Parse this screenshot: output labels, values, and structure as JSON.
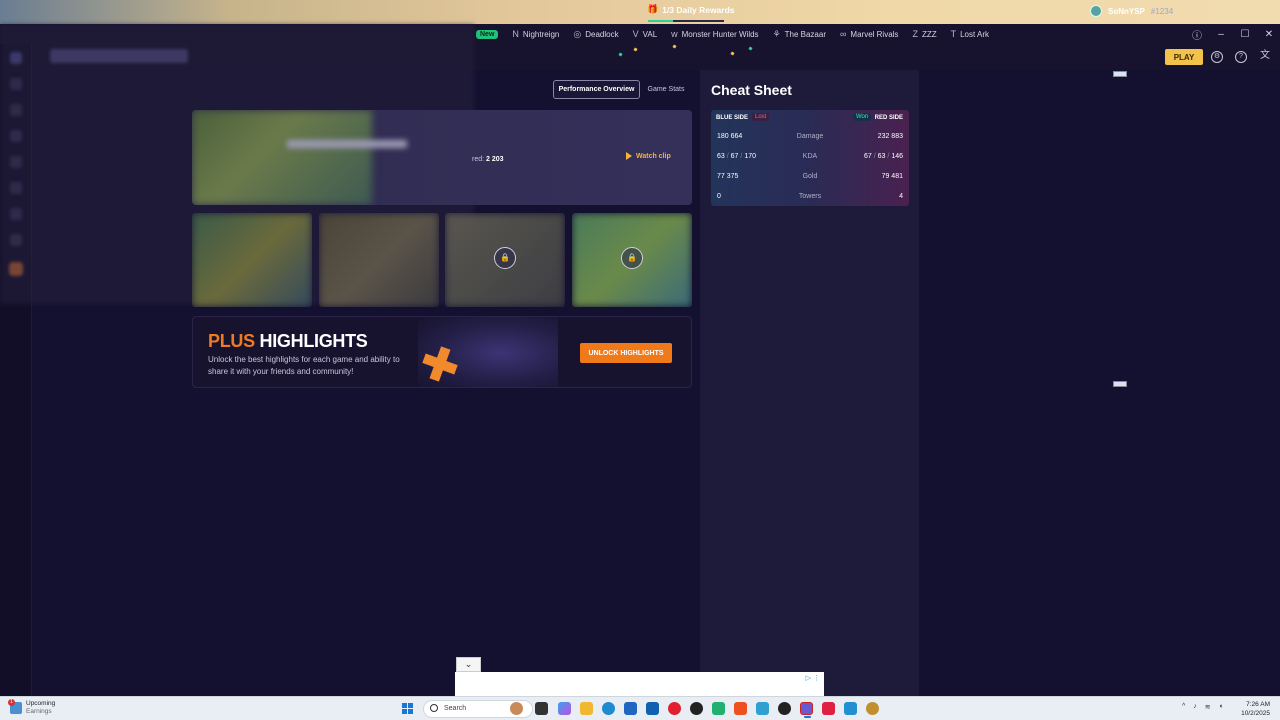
{
  "game_tabs": [
    {
      "label": "New",
      "icon": "new-badge",
      "badge": true
    },
    {
      "label": "Nightreign",
      "icon": "nightreign-icon"
    },
    {
      "label": "Deadlock",
      "icon": "deadlock-icon"
    },
    {
      "label": "VAL",
      "icon": "valorant-icon"
    },
    {
      "label": "Monster Hunter Wilds",
      "icon": "mhw-icon"
    },
    {
      "label": "The Bazaar",
      "icon": "bazaar-icon"
    },
    {
      "label": "Marvel Rivals",
      "icon": "marvel-rivals-icon"
    },
    {
      "label": "ZZZ",
      "icon": "zzz-icon"
    },
    {
      "label": "Lost Ark",
      "icon": "lost-ark-icon"
    }
  ],
  "daily_rewards": {
    "label": "1/3 Daily Rewards",
    "progress": 0.33,
    "accent": "#29d398"
  },
  "user": {
    "name": "SoNnYSP",
    "tag": "#1234"
  },
  "play_button": "PLAY",
  "tabs": {
    "performance": "Performance Overview",
    "stats": "Game Stats"
  },
  "match": {
    "played_label": "red:",
    "played_value": "2 203",
    "watch_clip": "Watch clip"
  },
  "promo": {
    "title_plus": "PLUS",
    "title_rest": "HIGHLIGHTS",
    "description": "Unlock the best highlights for each game and ability to share it with your friends and community!",
    "button": "UNLOCK HIGHLIGHTS"
  },
  "cheat_sheet": {
    "title": "Cheat Sheet",
    "blue_side": "BLUE SIDE",
    "red_side": "RED SIDE",
    "blue_result": "Lost",
    "red_result": "Won",
    "rows": [
      {
        "label": "Damage",
        "blue": "180 664",
        "red": "232 883"
      },
      {
        "label": "KDA",
        "blue_k": "63",
        "blue_d": "67",
        "blue_a": "170",
        "red_k": "67",
        "red_d": "63",
        "red_a": "146"
      },
      {
        "label": "Gold",
        "blue": "77 375",
        "red": "79 481"
      },
      {
        "label": "Towers",
        "blue": "0",
        "red": "4"
      }
    ]
  },
  "taskbar": {
    "weather_title": "Upcoming",
    "weather_sub": "Earnings",
    "weather_badge": "1",
    "search": "Search",
    "time": "7:26 AM",
    "date": "10/2/2025"
  },
  "colors": {
    "accent_orange": "#f07a1a",
    "play_yellow": "#f3c24b",
    "bg": "#141030",
    "won": "#3fe0b4",
    "lost": "#ff5a7a"
  }
}
